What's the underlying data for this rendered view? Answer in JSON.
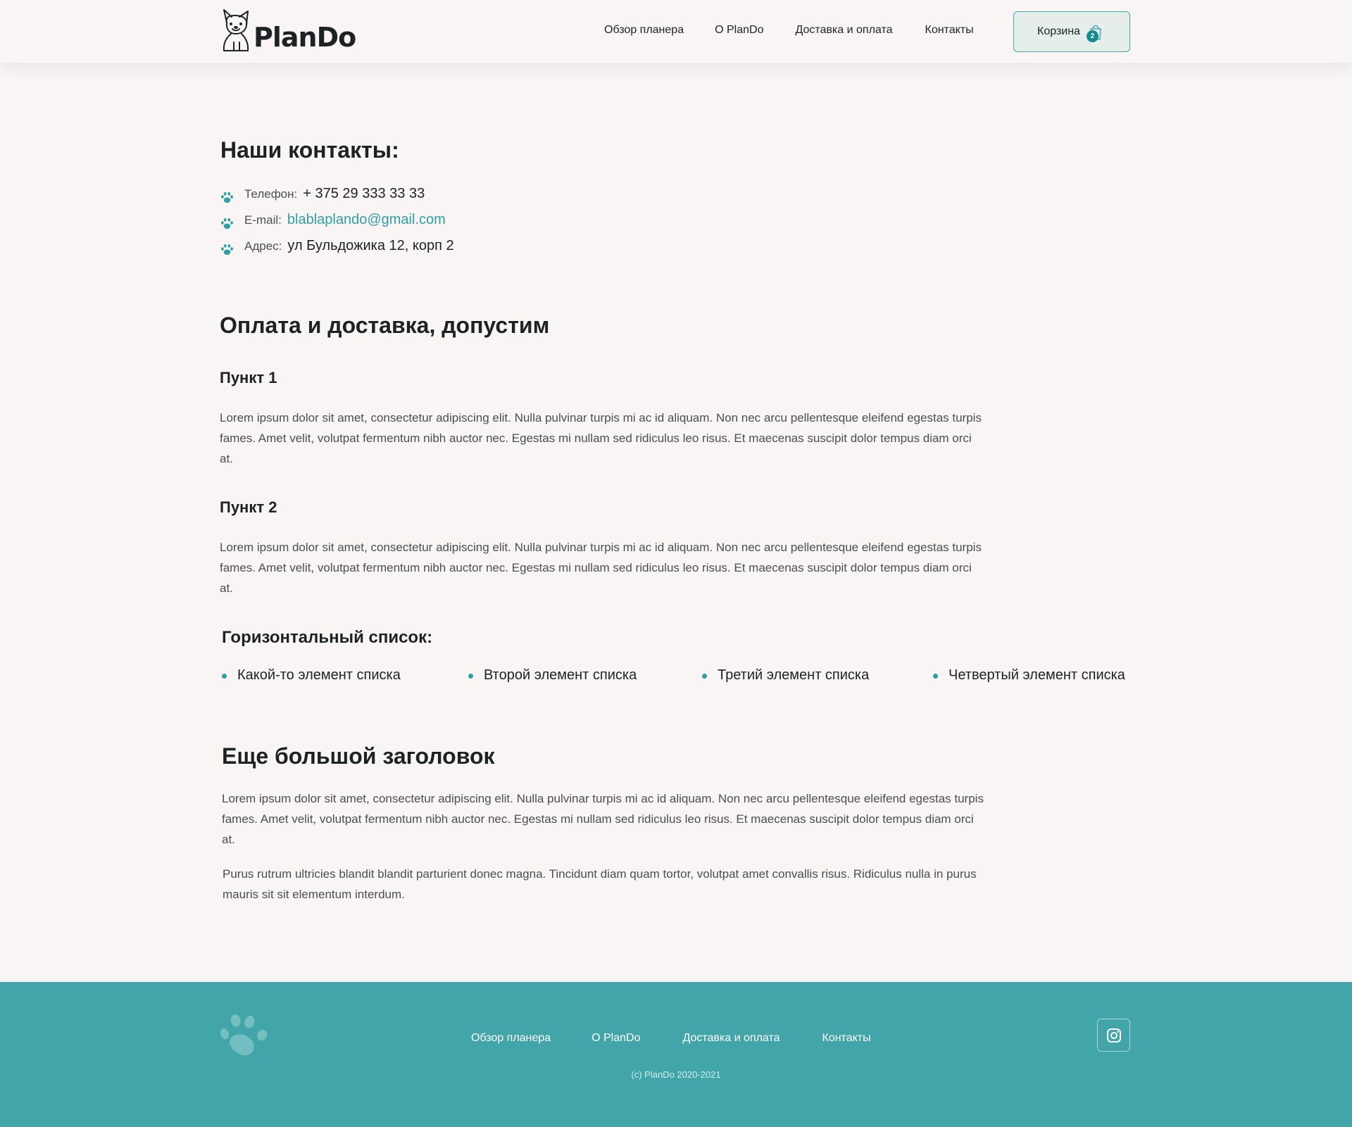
{
  "header": {
    "logo_text": "PlanDo",
    "nav": [
      "Обзор планера",
      "О PlanDo",
      "Доставка и оплата",
      "Контакты"
    ],
    "cart_label": "Корзина",
    "cart_count": "2"
  },
  "contacts": {
    "title": "Наши контакты:",
    "phone_label": "Телефон:",
    "phone_value": "+ 375 29 333 33 33",
    "email_label": "E-mail:",
    "email_value": "blablaplando@gmail.com",
    "address_label": "Адрес:",
    "address_value": "ул Бульдожика 12, корп 2"
  },
  "delivery": {
    "title": "Оплата и доставка, допустим",
    "point1_title": "Пункт 1",
    "point1_text": "Lorem ipsum dolor sit amet, consectetur adipiscing elit. Nulla pulvinar turpis mi ac id aliquam. Non nec arcu pellentesque eleifend egestas turpis fames. Amet velit, volutpat fermentum nibh auctor nec. Egestas mi nullam sed ridiculus leo risus. Et maecenas suscipit dolor tempus diam orci at.",
    "point2_title": "Пункт 2",
    "point2_text": "Lorem ipsum dolor sit amet, consectetur adipiscing elit. Nulla pulvinar turpis mi ac id aliquam. Non nec arcu pellentesque eleifend egestas turpis fames. Amet velit, volutpat fermentum nibh auctor nec. Egestas mi nullam sed ridiculus leo risus. Et maecenas suscipit dolor tempus diam orci at."
  },
  "hlist": {
    "title": "Горизонтальный список:",
    "items": [
      "Какой-то элемент списка",
      "Второй элемент списка",
      "Третий элемент списка",
      "Четвертый элемент списка"
    ]
  },
  "big_section": {
    "title": "Еще большой заголовок",
    "para1": "Lorem ipsum dolor sit amet, consectetur adipiscing elit. Nulla pulvinar turpis mi ac id aliquam. Non nec arcu pellentesque eleifend egestas turpis fames. Amet velit, volutpat fermentum nibh auctor nec. Egestas mi nullam sed ridiculus leo risus. Et maecenas suscipit dolor tempus diam orci at.",
    "para2": "Purus rutrum ultricies blandit blandit parturient donec magna. Tincidunt diam quam tortor, volutpat amet convallis risus. Ridiculus nulla in purus mauris sit sit elementum interdum."
  },
  "footer": {
    "nav": [
      "Обзор планера",
      "О PlanDo",
      "Доставка и оплата",
      "Контакты"
    ],
    "copyright": "(c) PlanDo 2020-2021"
  },
  "colors": {
    "accent": "#42a5aa",
    "link": "#2f9fa6",
    "background": "#f8f5f4",
    "text": "#1d2325"
  },
  "icons": {
    "logo": "bulldog-icon",
    "cart": "shopping-bag-icon",
    "bullet": "paw-icon",
    "social": "instagram-icon"
  }
}
